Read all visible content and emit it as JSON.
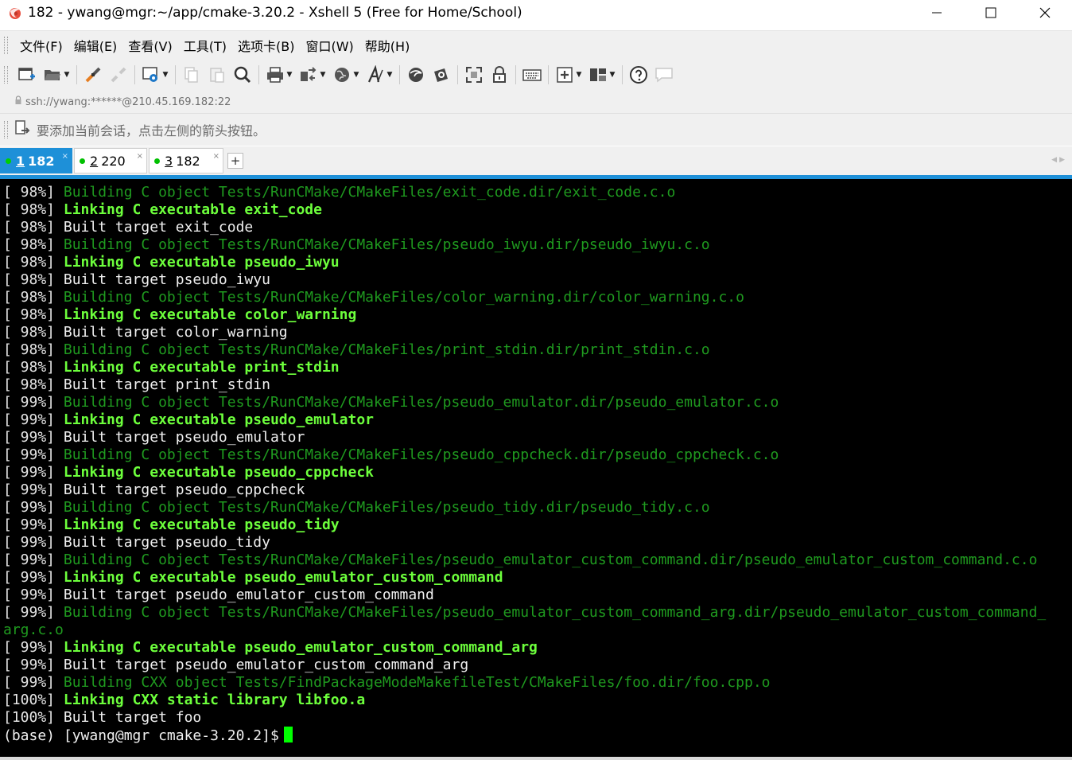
{
  "window": {
    "title": "182 - ywang@mgr:~/app/cmake-3.20.2 - Xshell 5 (Free for Home/School)",
    "controls": [
      "minimize",
      "maximize",
      "close"
    ]
  },
  "menu": {
    "items": [
      "文件(F)",
      "编辑(E)",
      "查看(V)",
      "工具(T)",
      "选项卡(B)",
      "窗口(W)",
      "帮助(H)"
    ]
  },
  "toolbar": {
    "icons": [
      "new-session-icon",
      "open-folder-icon",
      "connect-icon",
      "disconnect-icon",
      "properties-icon",
      "copy-icon",
      "paste-icon",
      "find-icon",
      "print-icon",
      "transfer-icon",
      "globe-icon",
      "font-icon",
      "xftp-icon",
      "xmanager-icon",
      "fullscreen-icon",
      "lock-icon",
      "keyboard-icon",
      "add-pane-icon",
      "layout-icon",
      "help-icon",
      "chat-icon"
    ]
  },
  "address": {
    "text": "ssh://ywang:******@210.45.169.182:22"
  },
  "hint": {
    "text": "要添加当前会话，点击左侧的箭头按钮。"
  },
  "tabs": [
    {
      "num": "1",
      "label": "182",
      "active": true
    },
    {
      "num": "2",
      "label": "220",
      "active": false
    },
    {
      "num": "3",
      "label": "182",
      "active": false
    }
  ],
  "tab_add_label": "+",
  "tab_close_label": "×",
  "terminal": {
    "colors": {
      "background": "#000000",
      "building": "#1f9a1f",
      "linking": "#6dff3c",
      "text": "#f0f0f0",
      "cursor": "#00ff00"
    },
    "lines": [
      {
        "prefix": "[ 98%] ",
        "text": "Building C object Tests/RunCMake/CMakeFiles/exit_code.dir/exit_code.c.o",
        "style": "dim"
      },
      {
        "prefix": "[ 98%] ",
        "text": "Linking C executable exit_code",
        "style": "bold"
      },
      {
        "prefix": "[ 98%] ",
        "text": "Built target exit_code",
        "style": "white"
      },
      {
        "prefix": "[ 98%] ",
        "text": "Building C object Tests/RunCMake/CMakeFiles/pseudo_iwyu.dir/pseudo_iwyu.c.o",
        "style": "dim"
      },
      {
        "prefix": "[ 98%] ",
        "text": "Linking C executable pseudo_iwyu",
        "style": "bold"
      },
      {
        "prefix": "[ 98%] ",
        "text": "Built target pseudo_iwyu",
        "style": "white"
      },
      {
        "prefix": "[ 98%] ",
        "text": "Building C object Tests/RunCMake/CMakeFiles/color_warning.dir/color_warning.c.o",
        "style": "dim"
      },
      {
        "prefix": "[ 98%] ",
        "text": "Linking C executable color_warning",
        "style": "bold"
      },
      {
        "prefix": "[ 98%] ",
        "text": "Built target color_warning",
        "style": "white"
      },
      {
        "prefix": "[ 98%] ",
        "text": "Building C object Tests/RunCMake/CMakeFiles/print_stdin.dir/print_stdin.c.o",
        "style": "dim"
      },
      {
        "prefix": "[ 98%] ",
        "text": "Linking C executable print_stdin",
        "style": "bold"
      },
      {
        "prefix": "[ 98%] ",
        "text": "Built target print_stdin",
        "style": "white"
      },
      {
        "prefix": "[ 99%] ",
        "text": "Building C object Tests/RunCMake/CMakeFiles/pseudo_emulator.dir/pseudo_emulator.c.o",
        "style": "dim"
      },
      {
        "prefix": "[ 99%] ",
        "text": "Linking C executable pseudo_emulator",
        "style": "bold"
      },
      {
        "prefix": "[ 99%] ",
        "text": "Built target pseudo_emulator",
        "style": "white"
      },
      {
        "prefix": "[ 99%] ",
        "text": "Building C object Tests/RunCMake/CMakeFiles/pseudo_cppcheck.dir/pseudo_cppcheck.c.o",
        "style": "dim"
      },
      {
        "prefix": "[ 99%] ",
        "text": "Linking C executable pseudo_cppcheck",
        "style": "bold"
      },
      {
        "prefix": "[ 99%] ",
        "text": "Built target pseudo_cppcheck",
        "style": "white"
      },
      {
        "prefix": "[ 99%] ",
        "text": "Building C object Tests/RunCMake/CMakeFiles/pseudo_tidy.dir/pseudo_tidy.c.o",
        "style": "dim"
      },
      {
        "prefix": "[ 99%] ",
        "text": "Linking C executable pseudo_tidy",
        "style": "bold"
      },
      {
        "prefix": "[ 99%] ",
        "text": "Built target pseudo_tidy",
        "style": "white"
      },
      {
        "prefix": "[ 99%] ",
        "text": "Building C object Tests/RunCMake/CMakeFiles/pseudo_emulator_custom_command.dir/pseudo_emulator_custom_command.c.o",
        "style": "dim"
      },
      {
        "prefix": "[ 99%] ",
        "text": "Linking C executable pseudo_emulator_custom_command",
        "style": "bold"
      },
      {
        "prefix": "[ 99%] ",
        "text": "Built target pseudo_emulator_custom_command",
        "style": "white"
      },
      {
        "prefix": "[ 99%] ",
        "text": "Building C object Tests/RunCMake/CMakeFiles/pseudo_emulator_custom_command_arg.dir/pseudo_emulator_custom_command_",
        "style": "dim"
      },
      {
        "prefix": "",
        "text": "arg.c.o",
        "style": "dim"
      },
      {
        "prefix": "[ 99%] ",
        "text": "Linking C executable pseudo_emulator_custom_command_arg",
        "style": "bold"
      },
      {
        "prefix": "[ 99%] ",
        "text": "Built target pseudo_emulator_custom_command_arg",
        "style": "white"
      },
      {
        "prefix": "[ 99%] ",
        "text": "Building CXX object Tests/FindPackageModeMakefileTest/CMakeFiles/foo.dir/foo.cpp.o",
        "style": "dim"
      },
      {
        "prefix": "[100%] ",
        "text": "Linking CXX static library libfoo.a",
        "style": "bold"
      },
      {
        "prefix": "[100%] ",
        "text": "Built target foo",
        "style": "white"
      }
    ],
    "prompt": "(base) [ywang@mgr cmake-3.20.2]$"
  }
}
